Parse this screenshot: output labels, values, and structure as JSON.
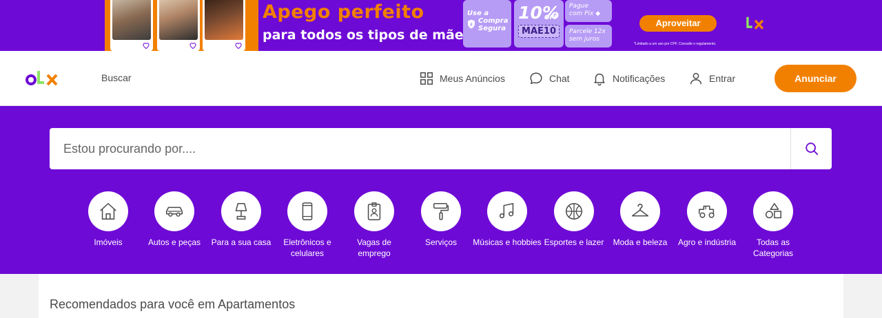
{
  "banner": {
    "headline": "Apego perfeito",
    "subheadline": "para todos os tipos de mãe",
    "promo_safe_line1": "Use a",
    "promo_safe_line2": "Compra",
    "promo_safe_line3": "Segura",
    "promo_discount": "10%",
    "promo_off": "OFF",
    "promo_code": "MAE10",
    "promo_pix_line1": "Pague",
    "promo_pix_line2": "com Pix",
    "promo_installments_line1": "Parcele 12x",
    "promo_installments_line2": "sem juros",
    "cta": "Aproveitar",
    "disclaimer": "*Limitado a um uso por CPF. Consulte o regulamento."
  },
  "header": {
    "search_link": "Buscar",
    "nav": {
      "my_ads": "Meus Anúncios",
      "chat": "Chat",
      "notifications": "Notificações",
      "login": "Entrar"
    },
    "cta": "Anunciar"
  },
  "search": {
    "placeholder": "Estou procurando por...."
  },
  "categories": [
    {
      "label": "Imóveis",
      "icon": "house-icon"
    },
    {
      "label": "Autos e peças",
      "icon": "car-icon"
    },
    {
      "label": "Para a sua casa",
      "icon": "lamp-icon"
    },
    {
      "label": "Eletrônicos e celulares",
      "icon": "phone-icon"
    },
    {
      "label": "Vagas de emprego",
      "icon": "badge-icon"
    },
    {
      "label": "Serviços",
      "icon": "paint-roller-icon"
    },
    {
      "label": "Músicas e hobbies",
      "icon": "music-note-icon"
    },
    {
      "label": "Esportes e lazer",
      "icon": "ball-icon"
    },
    {
      "label": "Moda e beleza",
      "icon": "hanger-icon"
    },
    {
      "label": "Agro e indústria",
      "icon": "tractor-icon"
    },
    {
      "label": "Todas as Categorias",
      "icon": "shapes-icon"
    }
  ],
  "recommendations": {
    "title": "Recomendados para você em Apartamentos"
  },
  "colors": {
    "brand_purple": "#6e0ad6",
    "brand_orange": "#f28000",
    "brand_green": "#8ce563"
  }
}
